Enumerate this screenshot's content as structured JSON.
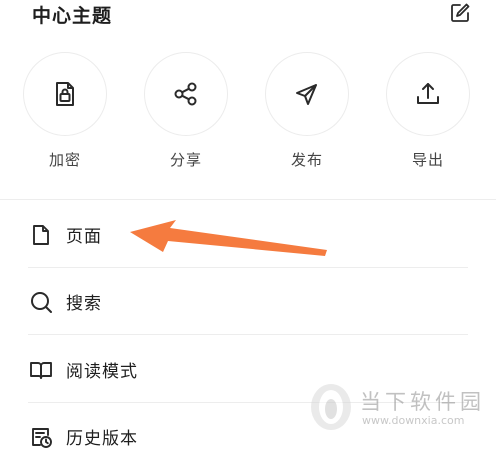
{
  "header": {
    "title": "中心主题",
    "edit_icon": "edit-icon"
  },
  "actions": [
    {
      "label": "加密",
      "icon": "encrypt-file-icon"
    },
    {
      "label": "分享",
      "icon": "share-icon"
    },
    {
      "label": "发布",
      "icon": "send-icon"
    },
    {
      "label": "导出",
      "icon": "export-icon"
    }
  ],
  "menu": [
    {
      "label": "页面",
      "icon": "page-icon"
    },
    {
      "label": "搜索",
      "icon": "search-icon"
    },
    {
      "label": "阅读模式",
      "icon": "book-icon"
    },
    {
      "label": "历史版本",
      "icon": "history-icon"
    }
  ],
  "annotation": {
    "arrow_color": "#f57b3f"
  },
  "watermark": {
    "name": "当下软件园",
    "url": "www.downxia.com"
  },
  "colors": {
    "text": "#1e1e1e",
    "secondary_text": "#444444",
    "divider": "#ededed",
    "accent": "#f57b3f"
  }
}
